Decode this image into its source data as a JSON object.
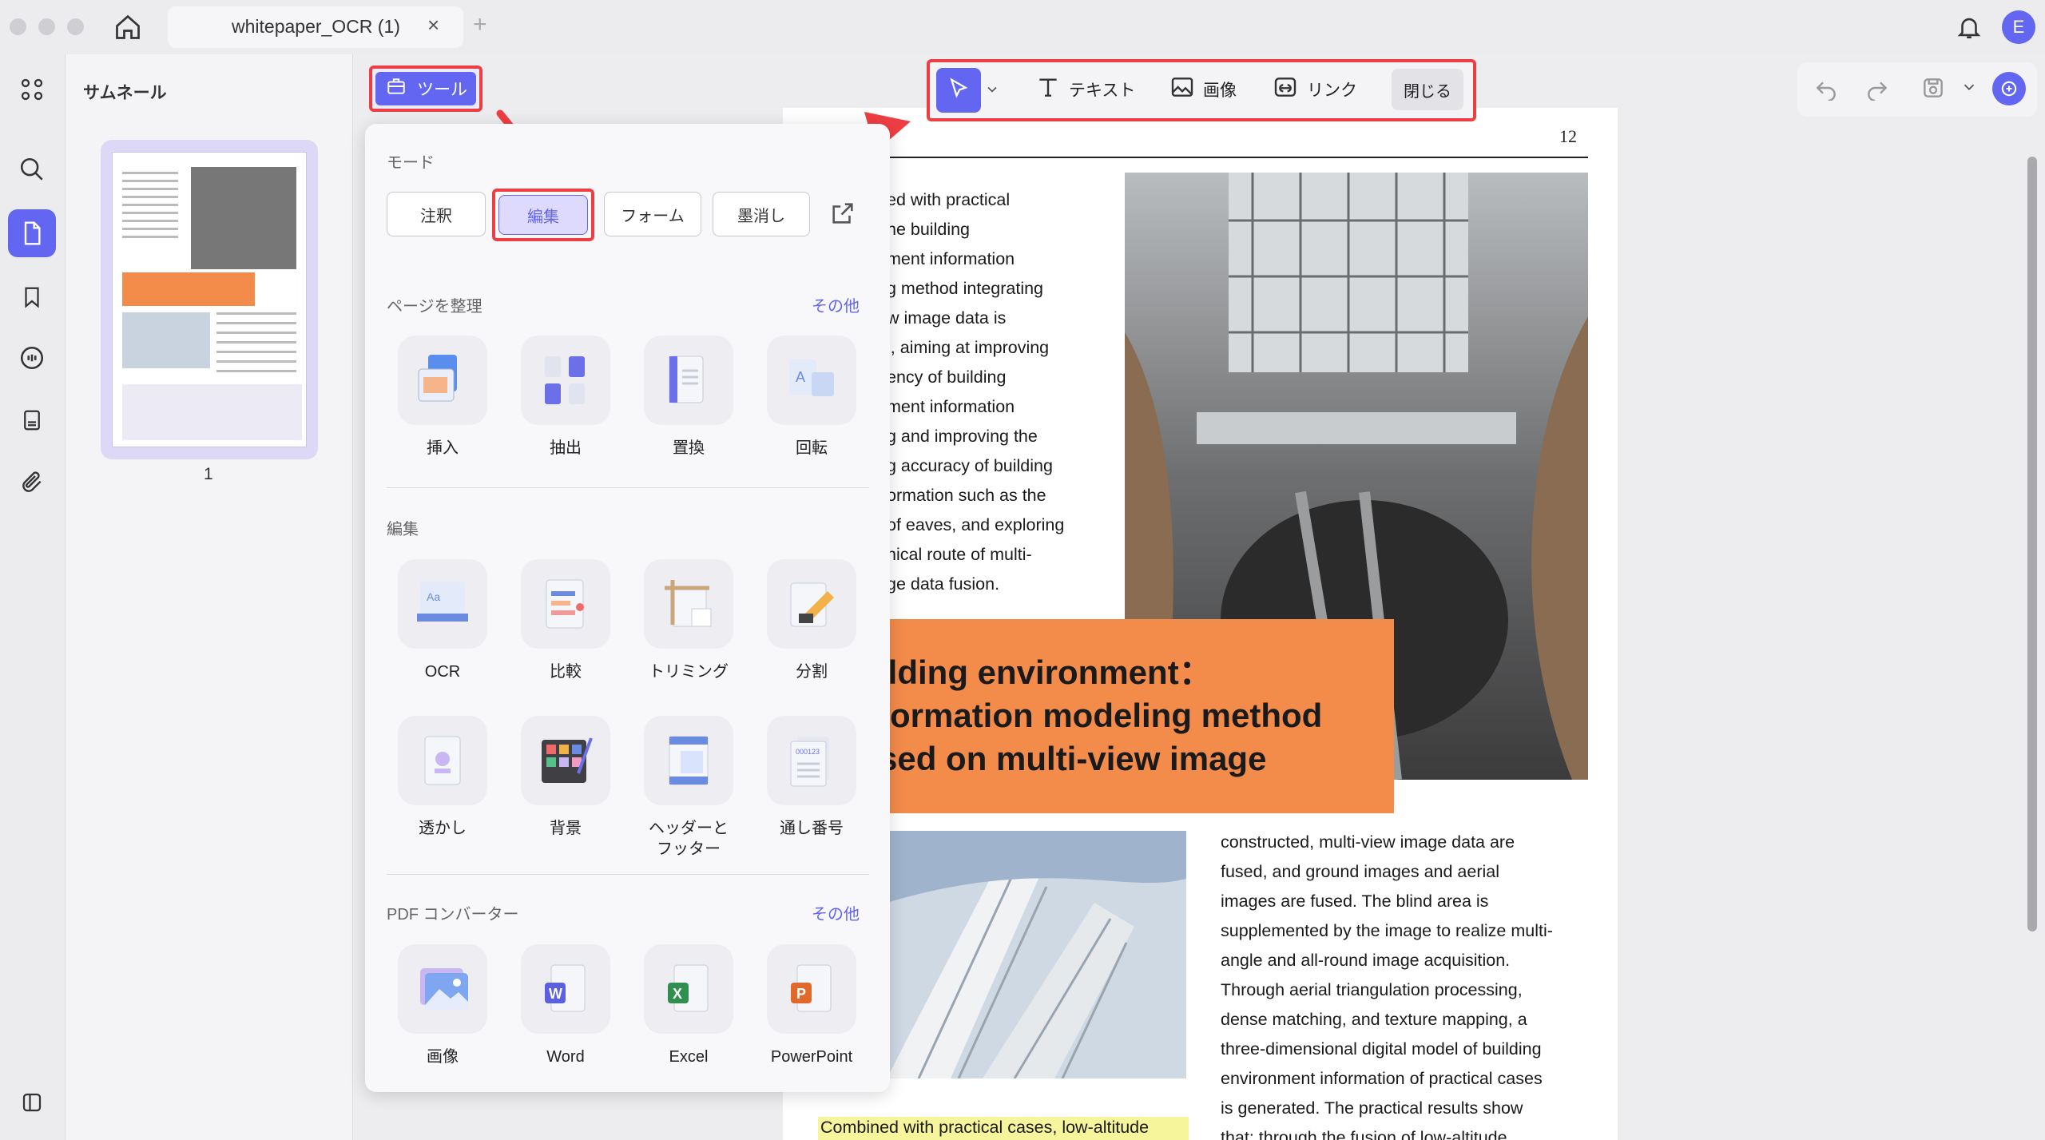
{
  "window": {
    "tab_title": "whitepaper_OCR (1)",
    "tab_close": "×",
    "tab_add": "+"
  },
  "sidebar": {
    "title": "サムネール",
    "page_number": "1",
    "avatar_letter": "E"
  },
  "tools_button": {
    "label": "ツール"
  },
  "edit_toolbar": {
    "text": "テキスト",
    "image": "画像",
    "link": "リンク",
    "close": "閉じる"
  },
  "dropdown": {
    "mode": {
      "label": "モード",
      "items": [
        "注釈",
        "編集",
        "フォーム",
        "墨消し"
      ]
    },
    "organize": {
      "label": "ページを整理",
      "more": "その他",
      "items": [
        "挿入",
        "抽出",
        "置換",
        "回転"
      ]
    },
    "edit": {
      "label": "編集",
      "items": [
        "OCR",
        "比較",
        "トリミング",
        "分割",
        "透かし",
        "背景",
        "ヘッダーと\nフッター",
        "通し番号"
      ]
    },
    "converter": {
      "label": "PDF コンバーター",
      "more": "その他",
      "items": [
        "画像",
        "Word",
        "Excel",
        "PowerPoint"
      ]
    }
  },
  "document": {
    "page_number": "12",
    "heading": [
      "ilding environment：",
      "formation modeling method",
      "sed on multi-view image"
    ],
    "column1": [
      "ed with practical",
      "he building",
      "ment information",
      "g method integrating",
      "w image data is",
      "l, aiming at improving",
      "ency of building",
      "ment information",
      "g and improving the",
      "g accuracy of building",
      "ormation such as the",
      "of eaves, and exploring",
      "nical route of multi-",
      "ge data fusion."
    ],
    "column2": [
      "constructed, multi-view image data are",
      "fused, and ground images and aerial",
      "images are fused. The blind area is",
      "supplemented by the image to realize multi-",
      "angle and all-round image acquisition.",
      "Through aerial triangulation processing,",
      "dense matching, and texture mapping, a",
      "three-dimensional digital model of building",
      "environment information of practical cases",
      "is generated. The practical results show",
      "that: through the fusion of low-altitude"
    ],
    "highlight": "Combined with practical cases, low-altitude"
  },
  "colors": {
    "accent": "#6366f1",
    "highlight_box": "#ef3e43",
    "orange_block": "#f38b4a"
  }
}
